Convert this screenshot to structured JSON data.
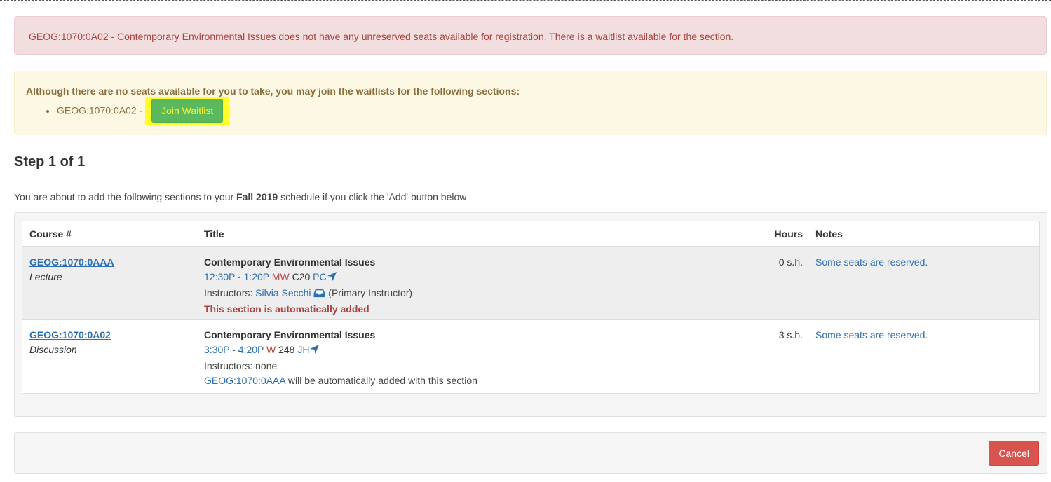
{
  "alert_error": {
    "message": "GEOG:1070:0A02 - Contemporary Environmental Issues does not have any unreserved seats available for registration. There is a waitlist available for the section."
  },
  "waitlist": {
    "heading": "Although there are no seats available for you to take, you may join the waitlists for the following sections:",
    "items": [
      {
        "section": "GEOG:1070:0A02",
        "separator": "-",
        "button_label": "Join Waitlist"
      }
    ]
  },
  "step": {
    "title": "Step 1 of 1",
    "intro_prefix": "You are about to add the following sections to your ",
    "term": "Fall 2019",
    "intro_suffix": " schedule if you click the 'Add' button below"
  },
  "table": {
    "headers": {
      "course": "Course #",
      "title": "Title",
      "hours": "Hours",
      "notes": "Notes"
    },
    "rows": [
      {
        "course": "GEOG:1070:0AAA",
        "type": "Lecture",
        "title": "Contemporary Environmental Issues",
        "time": "12:30P - 1:20P",
        "days": "MW",
        "room": "C20",
        "building": "PC",
        "instructors_label": "Instructors:",
        "instructor": "Silvia Secchi",
        "instructor_role": "(Primary Instructor)",
        "extra": "This section is automatically added",
        "hours": "0 s.h.",
        "notes": "Some seats are reserved."
      },
      {
        "course": "GEOG:1070:0A02",
        "type": "Discussion",
        "title": "Contemporary Environmental Issues",
        "time": "3:30P - 4:20P",
        "days": "W",
        "room": "248",
        "building": "JH",
        "instructors_text": "Instructors: none",
        "linked_course": "GEOG:1070:0AAA",
        "linked_suffix": " will be automatically added with this section",
        "hours": "3 s.h.",
        "notes": "Some seats are reserved."
      }
    ]
  },
  "footer": {
    "cancel_label": "Cancel"
  },
  "colors": {
    "danger": "#a94442",
    "warning": "#8a6d3b",
    "success_button": "#5cb85c",
    "highlight": "#ffff24",
    "link": "#2a6fb5",
    "cancel_button": "#d9534f"
  },
  "icons": {
    "location": "location-arrow-icon",
    "instructor_email": "inbox-icon"
  }
}
